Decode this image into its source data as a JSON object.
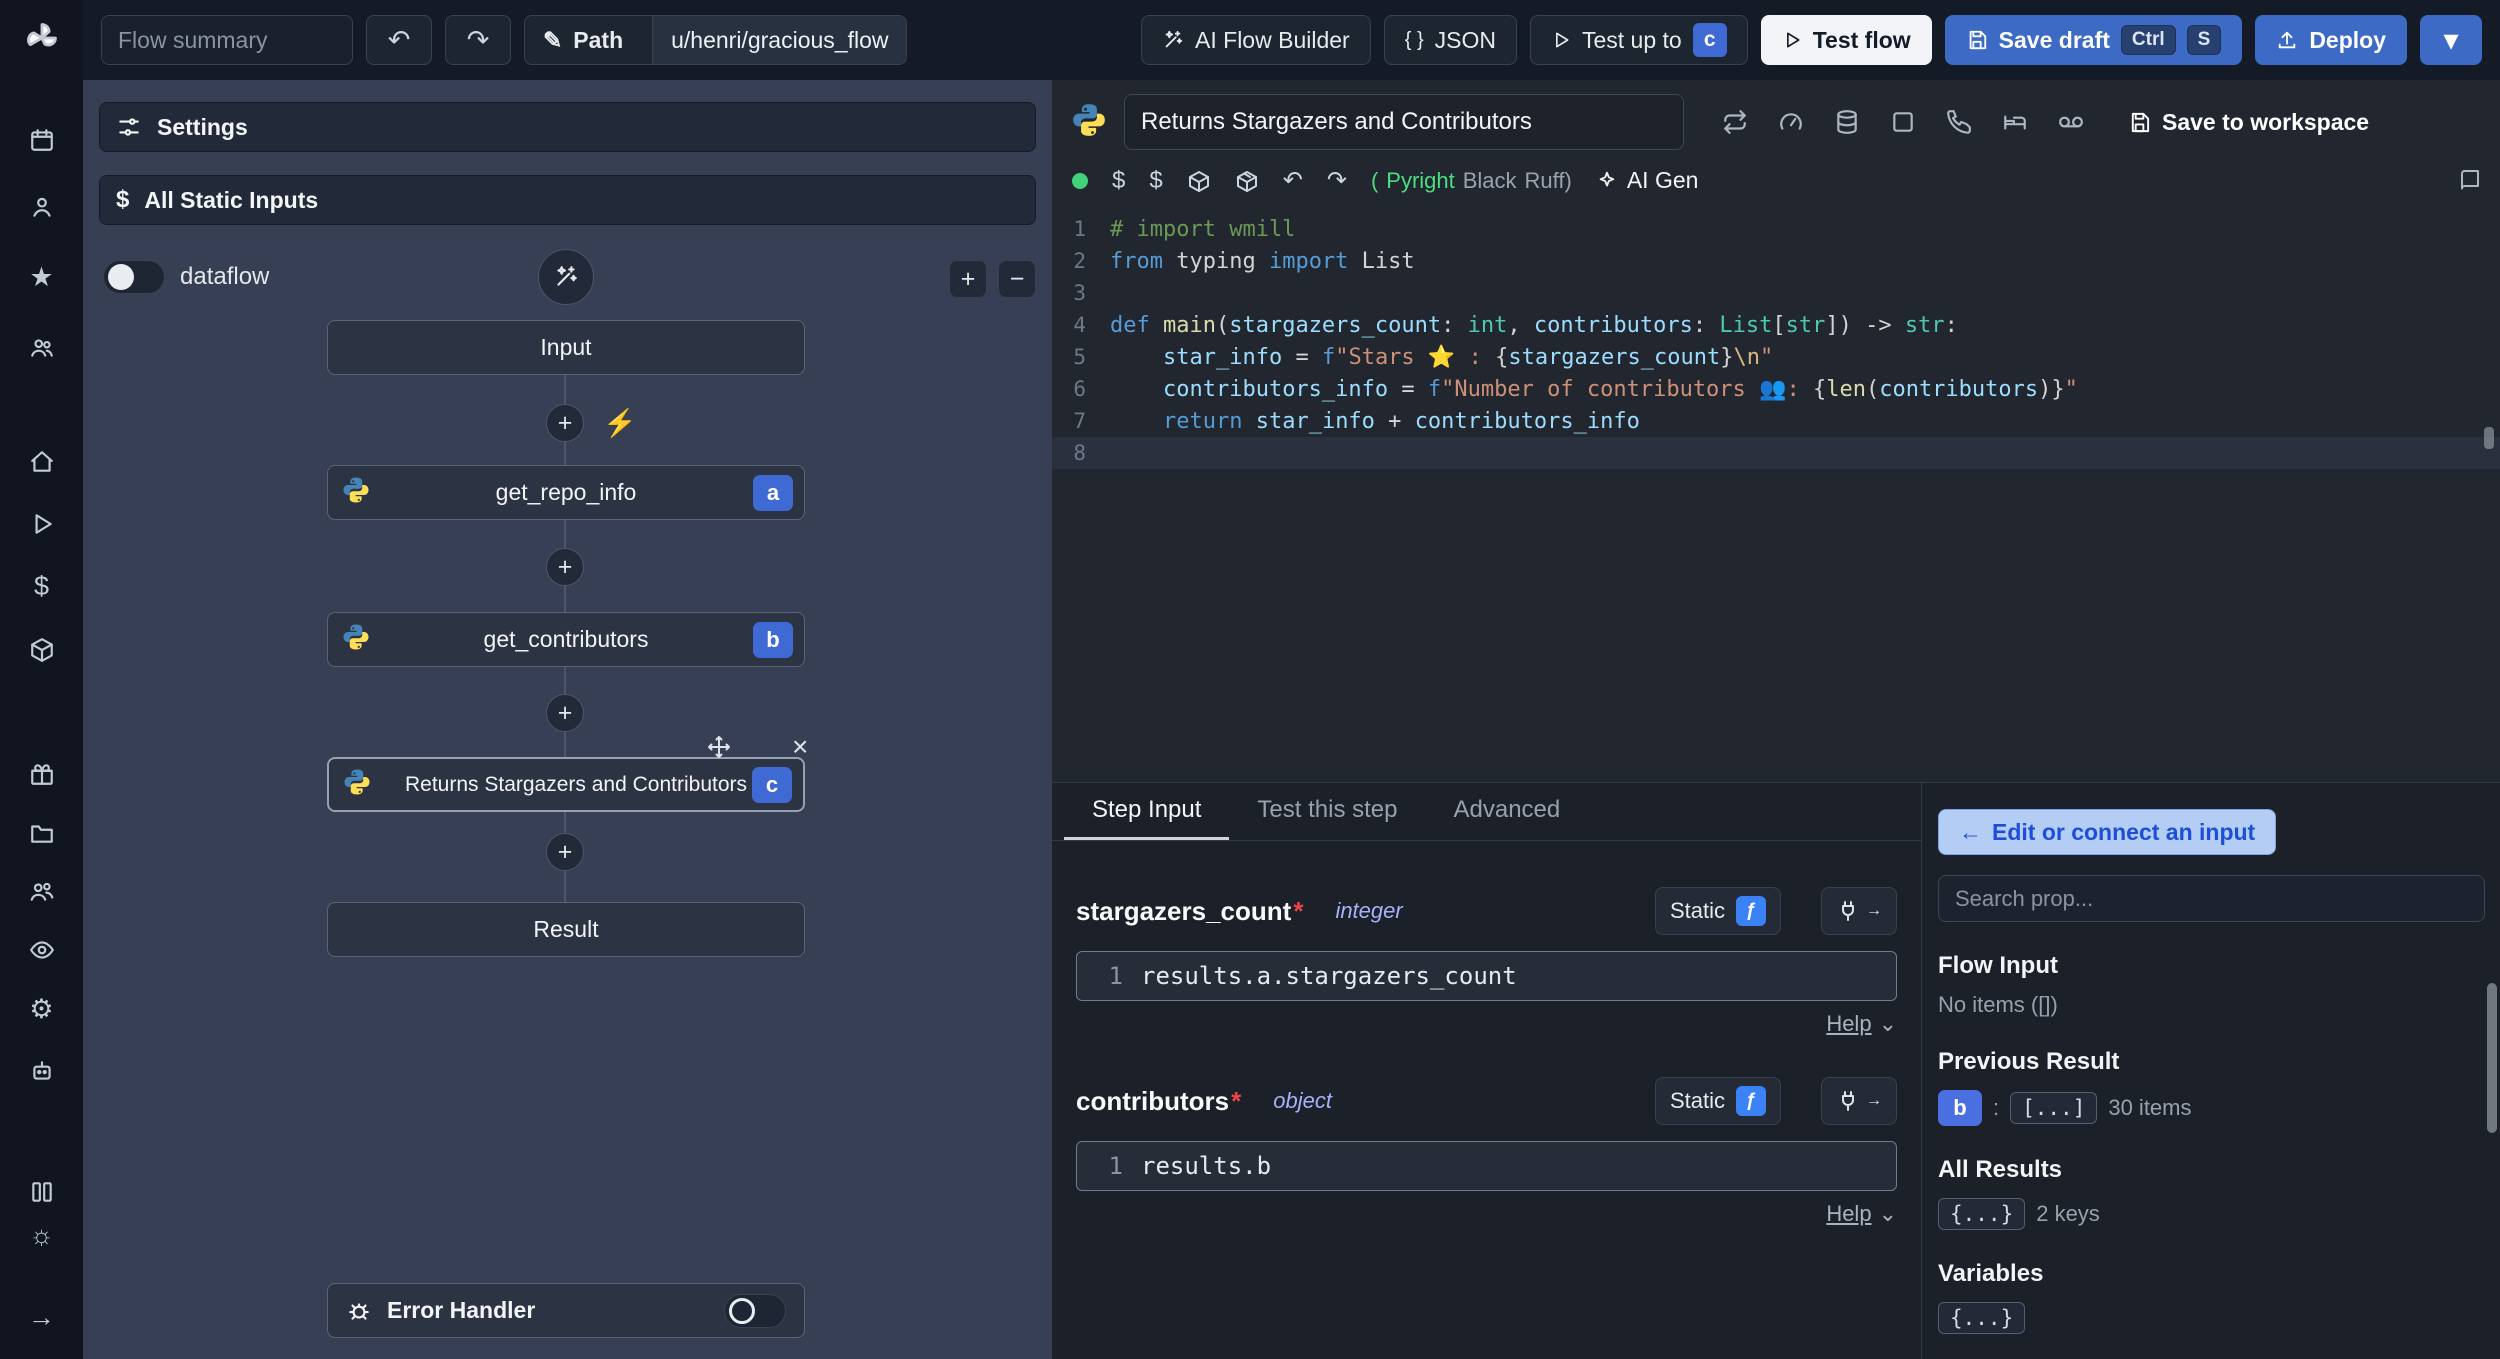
{
  "icons": {
    "star": "★",
    "dollar": "$",
    "gear": "⚙",
    "sun": "☼",
    "arrow_right": "→",
    "undo": "↶",
    "redo": "↷",
    "pencil": "✎",
    "plus": "+",
    "minus": "−",
    "bolt": "⚡",
    "close": "×",
    "caret_down": "⌄",
    "chevron_down": "▾",
    "left_arrow": "←",
    "braces": "{ }",
    "fn": "ƒ"
  },
  "topbar": {
    "flow_summary_placeholder": "Flow summary",
    "path_label": "Path",
    "path_value": "u/henri/gracious_flow",
    "ai_flow_builder": "AI Flow Builder",
    "json": "JSON",
    "test_up_to": "Test up to",
    "test_up_to_step": "c",
    "test_flow": "Test flow",
    "save_draft": "Save draft",
    "save_draft_kbd1": "Ctrl",
    "save_draft_kbd2": "S",
    "deploy": "Deploy"
  },
  "flow_panel": {
    "settings": "Settings",
    "all_static_inputs": "All Static Inputs",
    "dataflow_label": "dataflow",
    "nodes": {
      "input": "Input",
      "step_a_label": "get_repo_info",
      "step_a_badge": "a",
      "step_b_label": "get_contributors",
      "step_b_badge": "b",
      "step_c_label": "Returns Stargazers and Contributors",
      "step_c_badge": "c",
      "result": "Result",
      "error_handler": "Error Handler"
    }
  },
  "editor": {
    "title": "Returns Stargazers and Contributors",
    "save_to_workspace": "Save to workspace",
    "assistants": {
      "open": "(",
      "pyright": "Pyright",
      "black": "Black",
      "ruff": "Ruff)"
    },
    "ai_gen": "AI Gen",
    "current_line": 8,
    "code_lines": [
      [
        [
          "# import wmill",
          "c-com"
        ]
      ],
      [
        [
          "from",
          "c-kw"
        ],
        [
          " typing ",
          "c-pln"
        ],
        [
          "import",
          "c-kw"
        ],
        [
          " List",
          "c-pln"
        ]
      ],
      [],
      [
        [
          "def ",
          "c-kw"
        ],
        [
          "main",
          "c-fn"
        ],
        [
          "(",
          "c-pln"
        ],
        [
          "stargazers_count",
          "c-par"
        ],
        [
          ": ",
          "c-pln"
        ],
        [
          "int",
          "c-typ"
        ],
        [
          ", ",
          "c-pln"
        ],
        [
          "contributors",
          "c-par"
        ],
        [
          ": ",
          "c-pln"
        ],
        [
          "List",
          "c-typ"
        ],
        [
          "[",
          "c-pln"
        ],
        [
          "str",
          "c-typ"
        ],
        [
          "]",
          "c-pln"
        ],
        [
          ") -> ",
          "c-pln"
        ],
        [
          "str",
          "c-typ"
        ],
        [
          ":",
          "c-pln"
        ]
      ],
      [
        [
          "    ",
          "c-pln"
        ],
        [
          "star_info",
          "c-var"
        ],
        [
          " = ",
          "c-pln"
        ],
        [
          "f",
          "c-kw"
        ],
        [
          "\"Stars ",
          "c-str"
        ],
        [
          "⭐",
          "c-emo"
        ],
        [
          " : ",
          "c-str"
        ],
        [
          "{",
          "c-pln"
        ],
        [
          "stargazers_count",
          "c-var"
        ],
        [
          "}",
          "c-pln"
        ],
        [
          "\\n",
          "c-esc"
        ],
        [
          "\"",
          "c-str"
        ]
      ],
      [
        [
          "    ",
          "c-pln"
        ],
        [
          "contributors_info",
          "c-var"
        ],
        [
          " = ",
          "c-pln"
        ],
        [
          "f",
          "c-kw"
        ],
        [
          "\"Number of contributors ",
          "c-str"
        ],
        [
          "👥",
          "c-emo"
        ],
        [
          ": ",
          "c-str"
        ],
        [
          "{",
          "c-pln"
        ],
        [
          "len",
          "c-fn"
        ],
        [
          "(",
          "c-pln"
        ],
        [
          "contributors",
          "c-var"
        ],
        [
          ")}",
          "c-pln"
        ],
        [
          "\"",
          "c-str"
        ]
      ],
      [
        [
          "    ",
          "c-pln"
        ],
        [
          "return",
          "c-kw"
        ],
        [
          " ",
          "c-pln"
        ],
        [
          "star_info",
          "c-var"
        ],
        [
          " + ",
          "c-pln"
        ],
        [
          "contributors_info",
          "c-var"
        ]
      ],
      []
    ]
  },
  "step_panel": {
    "tabs": [
      "Step Input",
      "Test this step",
      "Advanced"
    ],
    "fields": [
      {
        "name": "stargazers_count",
        "required": "*",
        "type": "integer",
        "mode": "Static",
        "expr_line": "1",
        "expr": "results.a.stargazers_count",
        "help": "Help"
      },
      {
        "name": "contributors",
        "required": "*",
        "type": "object",
        "mode": "Static",
        "expr_line": "1",
        "expr": "results.b",
        "help": "Help"
      }
    ]
  },
  "props_panel": {
    "edit_connect": "Edit or connect an input",
    "search_placeholder": "Search prop...",
    "flow_input_title": "Flow Input",
    "flow_input_empty": "No items ([])",
    "previous_result_title": "Previous Result",
    "prev_badge": "b",
    "prev_colon": ":",
    "prev_preview": "[...]",
    "prev_count": "30 items",
    "all_results_title": "All Results",
    "all_results_preview": "{...}",
    "all_results_count": "2 keys",
    "variables_title": "Variables",
    "variables_preview": "{...}"
  }
}
